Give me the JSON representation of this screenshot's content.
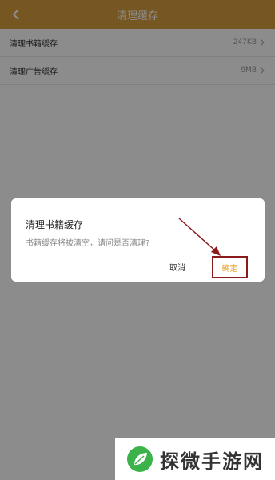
{
  "header": {
    "title": "清理缓存"
  },
  "list": {
    "items": [
      {
        "label": "清理书籍缓存",
        "value": "247KB"
      },
      {
        "label": "清理广告缓存",
        "value": "9MB"
      }
    ]
  },
  "dialog": {
    "title": "清理书籍缓存",
    "message": "书籍缓存将被清空，请问是否清理?",
    "cancel_label": "取消",
    "confirm_label": "确定"
  },
  "watermark": {
    "text": "探微手游网"
  },
  "colors": {
    "header_bg": "#d79d3d",
    "confirm_text": "#e8a431",
    "annotation": "#8b1a1a",
    "logo_green": "#3cb34a"
  },
  "icons": {
    "back": "chevron-left-icon",
    "row_arrow": "chevron-right-icon",
    "logo": "leaf-logo-icon"
  }
}
